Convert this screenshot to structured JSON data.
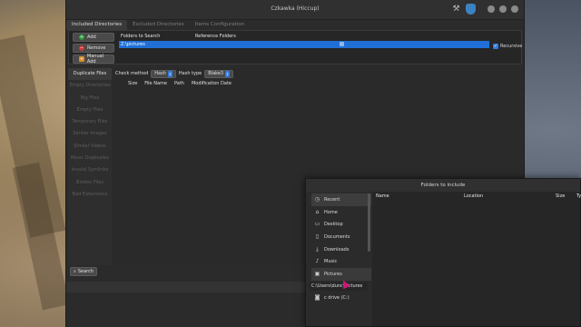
{
  "window": {
    "title": "Czkawka (Hiccup)",
    "icons": [
      "tools-icon",
      "shield-icon",
      "minimize-icon",
      "maximize-icon",
      "close-icon"
    ]
  },
  "tabs": [
    {
      "label": "Included Directories",
      "active": true
    },
    {
      "label": "Excluded Directories",
      "active": false
    },
    {
      "label": "Items Configuration",
      "active": false
    }
  ],
  "dir_buttons": {
    "add": "Add",
    "remove": "Remove",
    "manual_add": "Manual Add"
  },
  "dir_table": {
    "col_folders": "Folders to Search",
    "col_reference": "Reference Folders",
    "rows": [
      {
        "path": "Z:\\pictures",
        "reference": false
      }
    ]
  },
  "recursive": {
    "label": "Recursive",
    "checked": true
  },
  "tools": [
    {
      "label": "Duplicate Files",
      "active": true
    },
    {
      "label": "Empty Directories",
      "active": false
    },
    {
      "label": "Big Files",
      "active": false
    },
    {
      "label": "Empty Files",
      "active": false
    },
    {
      "label": "Temporary Files",
      "active": false
    },
    {
      "label": "Similar Images",
      "active": false
    },
    {
      "label": "Similar Videos",
      "active": false
    },
    {
      "label": "Music Duplicates",
      "active": false
    },
    {
      "label": "Invalid Symlinks",
      "active": false
    },
    {
      "label": "Broken Files",
      "active": false
    },
    {
      "label": "Bad Extensions",
      "active": false
    }
  ],
  "options": {
    "check_method_label": "Check method",
    "check_method_value": "Hash",
    "hash_type_label": "Hash type",
    "hash_type_value": "Blake3"
  },
  "results_columns": [
    "Size",
    "File Name",
    "Path",
    "Modification Date"
  ],
  "search_button": "Search",
  "dialog": {
    "title": "Folders to include",
    "places": [
      {
        "label": "Recent",
        "icon": "clock-icon"
      },
      {
        "label": "Home",
        "icon": "home-icon"
      },
      {
        "label": "Desktop",
        "icon": "folder-icon"
      },
      {
        "label": "Documents",
        "icon": "document-icon"
      },
      {
        "label": "Downloads",
        "icon": "download-icon"
      },
      {
        "label": "Music",
        "icon": "music-icon"
      },
      {
        "label": "Pictures",
        "icon": "picture-icon"
      }
    ],
    "path_value": "C:\\Users\\dunc\\Pictures",
    "drive": {
      "label": "c drive (C:)",
      "icon": "drive-icon"
    },
    "columns": [
      "Name",
      "Location",
      "Size",
      "Ty"
    ]
  }
}
